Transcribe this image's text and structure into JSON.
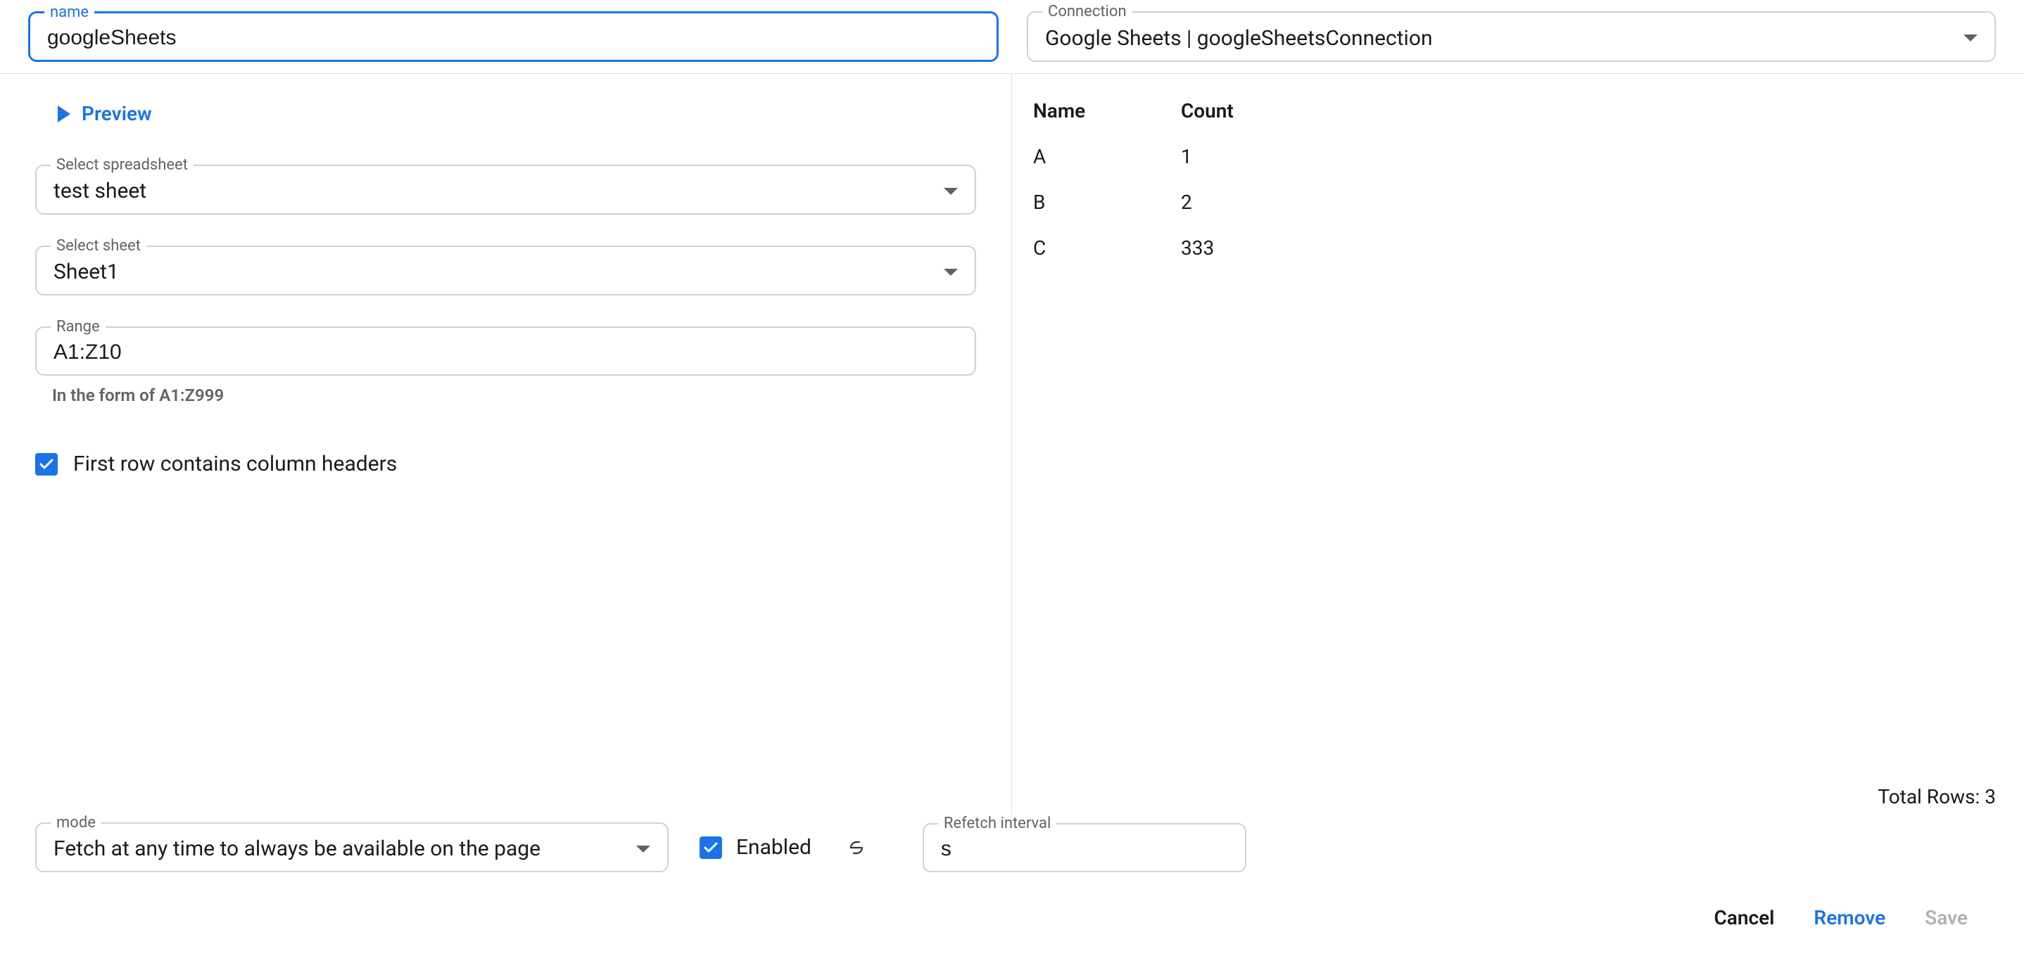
{
  "header": {
    "name_label": "name",
    "name_value": "googleSheets",
    "connection_label": "Connection",
    "connection_value": "Google Sheets | googleSheetsConnection"
  },
  "left": {
    "preview_label": "Preview",
    "spreadsheet_label": "Select spreadsheet",
    "spreadsheet_value": "test sheet",
    "sheet_label": "Select sheet",
    "sheet_value": "Sheet1",
    "range_label": "Range",
    "range_value": "A1:Z10",
    "range_helper": "In the form of A1:Z999",
    "first_row_headers_label": "First row contains column headers"
  },
  "right": {
    "columns": [
      "Name",
      "Count"
    ],
    "rows": [
      {
        "name": "A",
        "count": "1"
      },
      {
        "name": "B",
        "count": "2"
      },
      {
        "name": "C",
        "count": "333"
      }
    ],
    "total_rows_label": "Total Rows: 3"
  },
  "bottom": {
    "mode_label": "mode",
    "mode_value": "Fetch at any time to always be available on the page",
    "enabled_label": "Enabled",
    "refetch_label": "Refetch interval",
    "refetch_value": "s"
  },
  "actions": {
    "cancel": "Cancel",
    "remove": "Remove",
    "save": "Save"
  }
}
